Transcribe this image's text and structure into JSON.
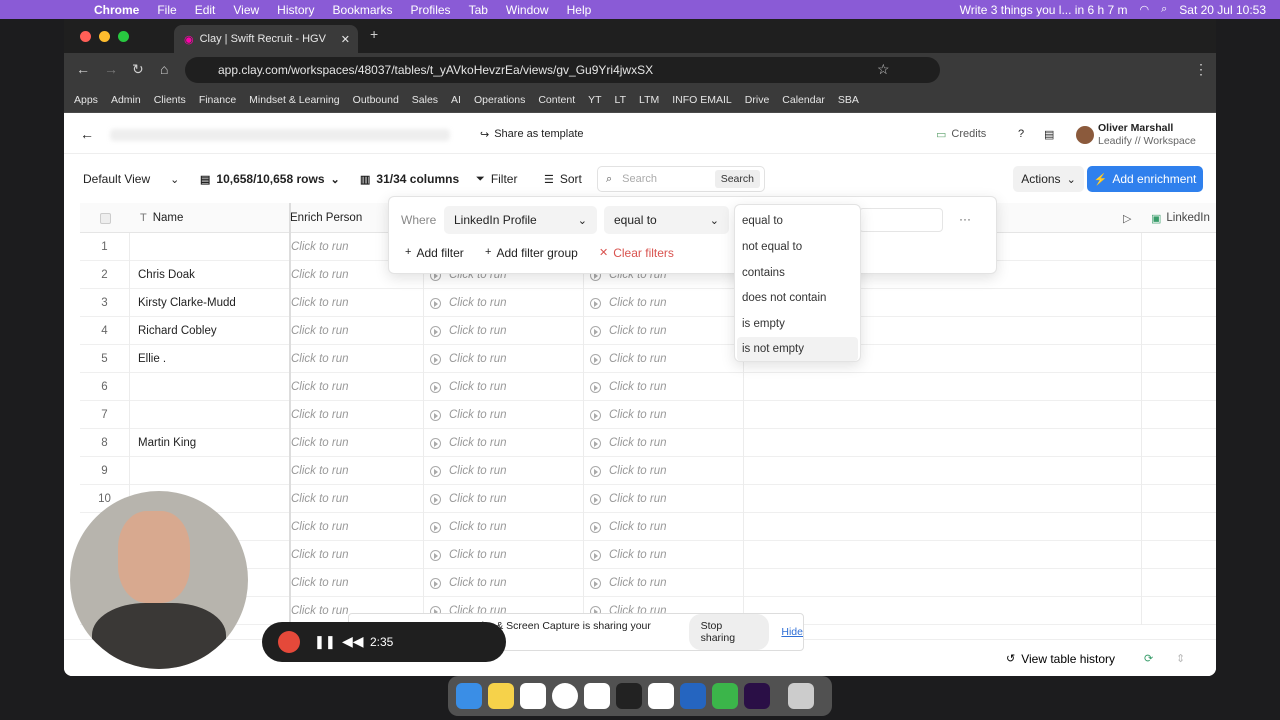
{
  "menubar": {
    "app": "Chrome",
    "items": [
      "File",
      "Edit",
      "View",
      "History",
      "Bookmarks",
      "Profiles",
      "Tab",
      "Window",
      "Help"
    ],
    "reminder": "Write 3 things you l... in 6 h 7 m",
    "datetime": "Sat 20 Jul  10:53"
  },
  "browser": {
    "tab_title": "Clay | Swift Recruit - HGV",
    "url": "app.clay.com/workspaces/48037/tables/t_yAVkoHevzrEa/views/gv_Gu9Yri4jwxSX",
    "bookmarks": [
      "Apps",
      "Admin",
      "Clients",
      "Finance",
      "Mindset & Learning",
      "Outbound",
      "Sales",
      "AI",
      "Operations",
      "Content",
      "YT",
      "LT",
      "LTM",
      "INFO EMAIL",
      "Drive",
      "Calendar",
      "SBA"
    ]
  },
  "app": {
    "share": "Share as template",
    "credits": "Credits",
    "user_name": "Oliver Marshall",
    "workspace": "Leadify // Workspace"
  },
  "toolbar": {
    "view": "Default View",
    "rows": "10,658/10,658 rows",
    "columns": "31/34 columns",
    "filter": "Filter",
    "sort": "Sort",
    "search_placeholder": "Search",
    "search_btn": "Search",
    "actions": "Actions",
    "add_enrichment": "Add enrichment"
  },
  "columns": {
    "name": "Name",
    "enrich": "Enrich Person",
    "linkedin": "LinkedIn"
  },
  "rows": [
    {
      "n": "1",
      "name": ""
    },
    {
      "n": "2",
      "name": "Chris Doak"
    },
    {
      "n": "3",
      "name": "Kirsty Clarke-Mudd"
    },
    {
      "n": "4",
      "name": "Richard Cobley"
    },
    {
      "n": "5",
      "name": "Ellie ."
    },
    {
      "n": "6",
      "name": ""
    },
    {
      "n": "7",
      "name": ""
    },
    {
      "n": "8",
      "name": "Martin King"
    },
    {
      "n": "9",
      "name": ""
    },
    {
      "n": "10",
      "name": ""
    },
    {
      "n": "",
      "name": ""
    },
    {
      "n": "",
      "name": ""
    },
    {
      "n": "",
      "name": ""
    },
    {
      "n": "",
      "name": ""
    }
  ],
  "run_text": "Click to run",
  "filter": {
    "where": "Where",
    "field": "LinkedIn Profile",
    "operator": "equal to",
    "add_filter": "Add filter",
    "add_group": "Add filter group",
    "clear": "Clear filters",
    "more": "···"
  },
  "operator_options": [
    "equal to",
    "not equal to",
    "contains",
    "does not contain",
    "is empty",
    "is not empty"
  ],
  "footer": {
    "history": "View table history"
  },
  "loom": {
    "message": "Loom – Screen Recorder & Screen Capture is sharing your screen.",
    "stop": "Stop sharing",
    "hide": "Hide",
    "timer": "2:35"
  }
}
